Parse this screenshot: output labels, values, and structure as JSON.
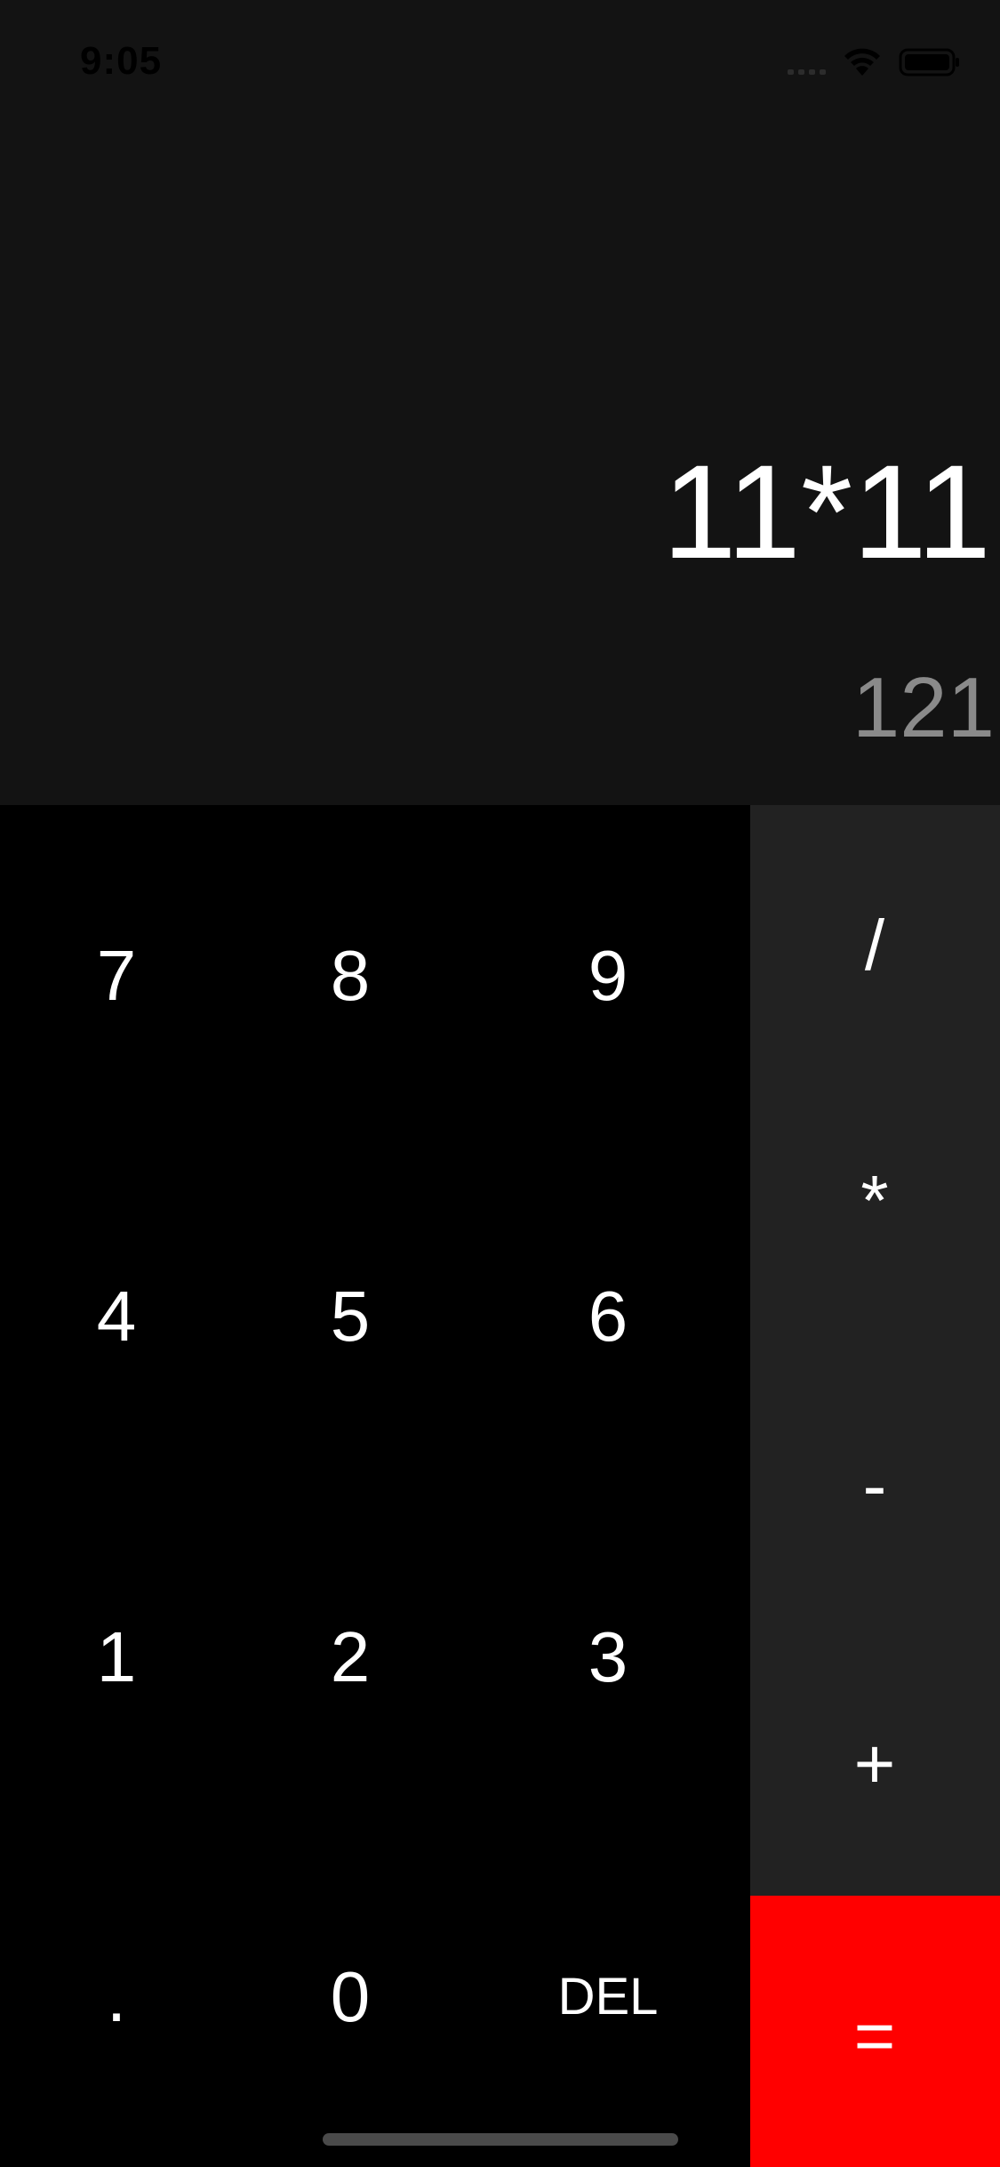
{
  "status_bar": {
    "time": "9:05",
    "icons": [
      "signal-icon",
      "wifi-icon",
      "battery-icon"
    ]
  },
  "display": {
    "expression": "11*11",
    "result": "121"
  },
  "keypad": {
    "rows": [
      [
        "7",
        "8",
        "9"
      ],
      [
        "4",
        "5",
        "6"
      ],
      [
        "1",
        "2",
        "3"
      ],
      [
        ".",
        "0",
        "DEL"
      ]
    ]
  },
  "operators": {
    "divide": "/",
    "multiply": "*",
    "subtract": "-",
    "add": "+",
    "equals": "="
  },
  "colors": {
    "display_background": "#131313",
    "keypad_background": "#000000",
    "operator_background": "#222222",
    "equals_background": "#ff0000",
    "result_text": "#8a8a8a"
  }
}
